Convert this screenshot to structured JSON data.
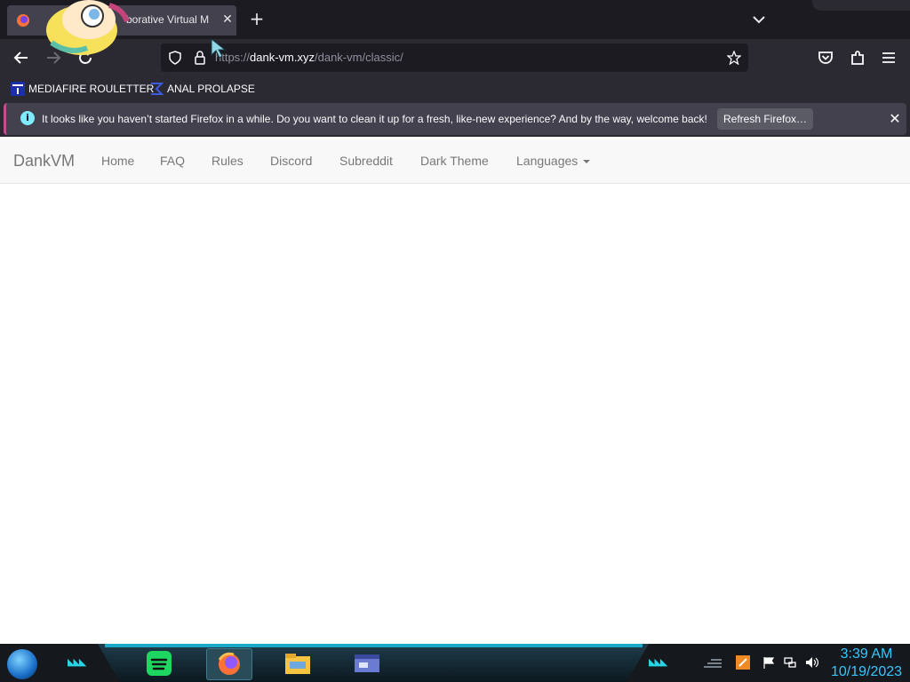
{
  "tab": {
    "title": "borative Virtual M",
    "close_glyph": "✕"
  },
  "new_tab_glyph": "+",
  "url": {
    "scheme": "https://",
    "host": "dank-vm.xyz",
    "path": "/dank-vm/classic/"
  },
  "bookmarks": [
    {
      "label": "MEDIAFIRE ROULETTER",
      "icon": "mft-logo-icon"
    },
    {
      "label": "ANAL PROLAPSE",
      "icon": "sigma-icon"
    }
  ],
  "notification": {
    "message": "It looks like you haven’t started Firefox in a while. Do you want to clean it up for a fresh, like-new experience? And by the way, welcome back!",
    "button_label": "Refresh Firefox…",
    "close_glyph": "✕"
  },
  "site_nav": {
    "brand": "DankVM",
    "links": [
      "Home",
      "FAQ",
      "Rules",
      "Discord",
      "Subreddit",
      "Dark Theme",
      "Languages"
    ]
  },
  "taskbar": {
    "time": "3:39 AM",
    "date": "10/19/2023",
    "apps": [
      "spotify-icon",
      "firefox-icon",
      "file-explorer-icon",
      "window-app-icon"
    ]
  },
  "colors": {
    "browser_dark": "#1c1b22",
    "toolbar": "#2b2a33",
    "site_nav_bg": "#f8f8f8",
    "site_link": "#777777",
    "clock": "#36c7ff"
  }
}
